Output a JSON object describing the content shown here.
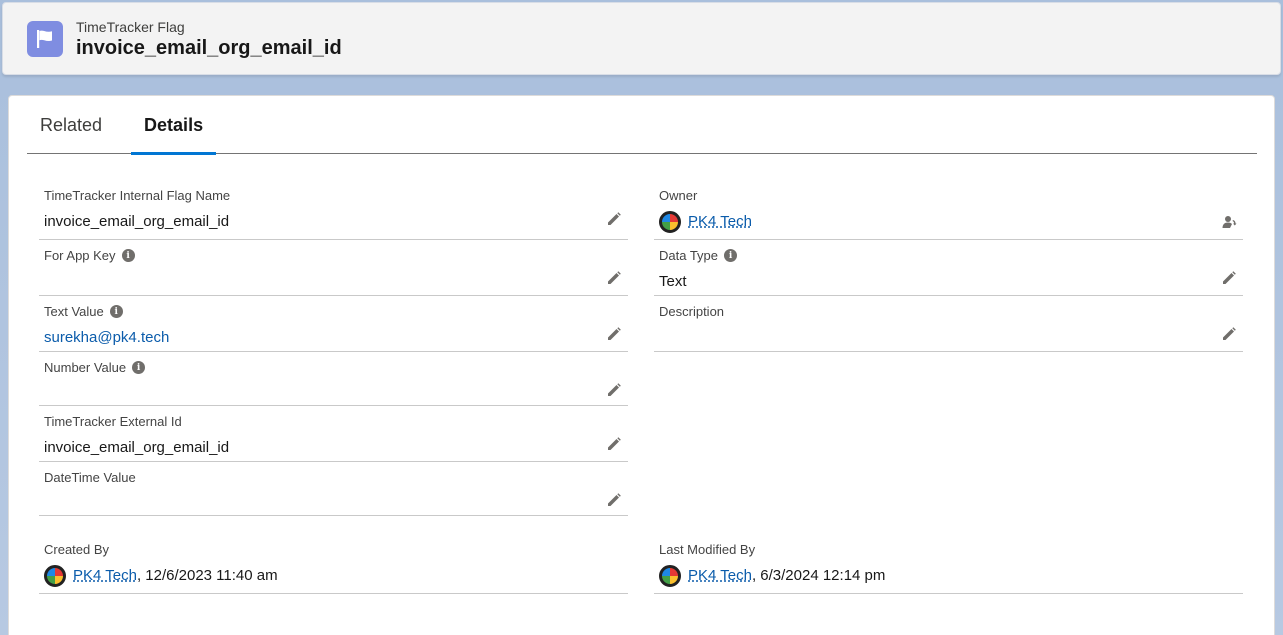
{
  "header": {
    "object_type": "TimeTracker Flag",
    "record_name": "invoice_email_org_email_id"
  },
  "tabs": [
    {
      "label": "Related"
    },
    {
      "label": "Details"
    }
  ],
  "fields": {
    "internal_flag_name": {
      "label": "TimeTracker Internal Flag Name",
      "value": "invoice_email_org_email_id"
    },
    "for_app_key": {
      "label": "For App Key",
      "value": ""
    },
    "text_value": {
      "label": "Text Value",
      "value": "surekha@pk4.tech"
    },
    "number_value": {
      "label": "Number Value",
      "value": ""
    },
    "external_id": {
      "label": "TimeTracker External Id",
      "value": "invoice_email_org_email_id"
    },
    "datetime_value": {
      "label": "DateTime Value",
      "value": ""
    },
    "owner": {
      "label": "Owner",
      "value": "PK4 Tech"
    },
    "data_type": {
      "label": "Data Type",
      "value": "Text"
    },
    "description": {
      "label": "Description",
      "value": ""
    },
    "created_by": {
      "label": "Created By",
      "user": "PK4 Tech",
      "separator": ",",
      "date": "12/6/2023 11:40 am"
    },
    "last_modified_by": {
      "label": "Last Modified By",
      "user": "PK4 Tech",
      "separator": ",",
      "date": "6/3/2024 12:14 pm"
    }
  },
  "colors": {
    "accent": "#0176d3",
    "link": "#0b5cab",
    "header_icon": "#7f8de1"
  },
  "icons": {
    "header": "flag-icon",
    "edit": "pencil-icon",
    "info": "info-icon",
    "change_owner": "change-owner-icon"
  }
}
